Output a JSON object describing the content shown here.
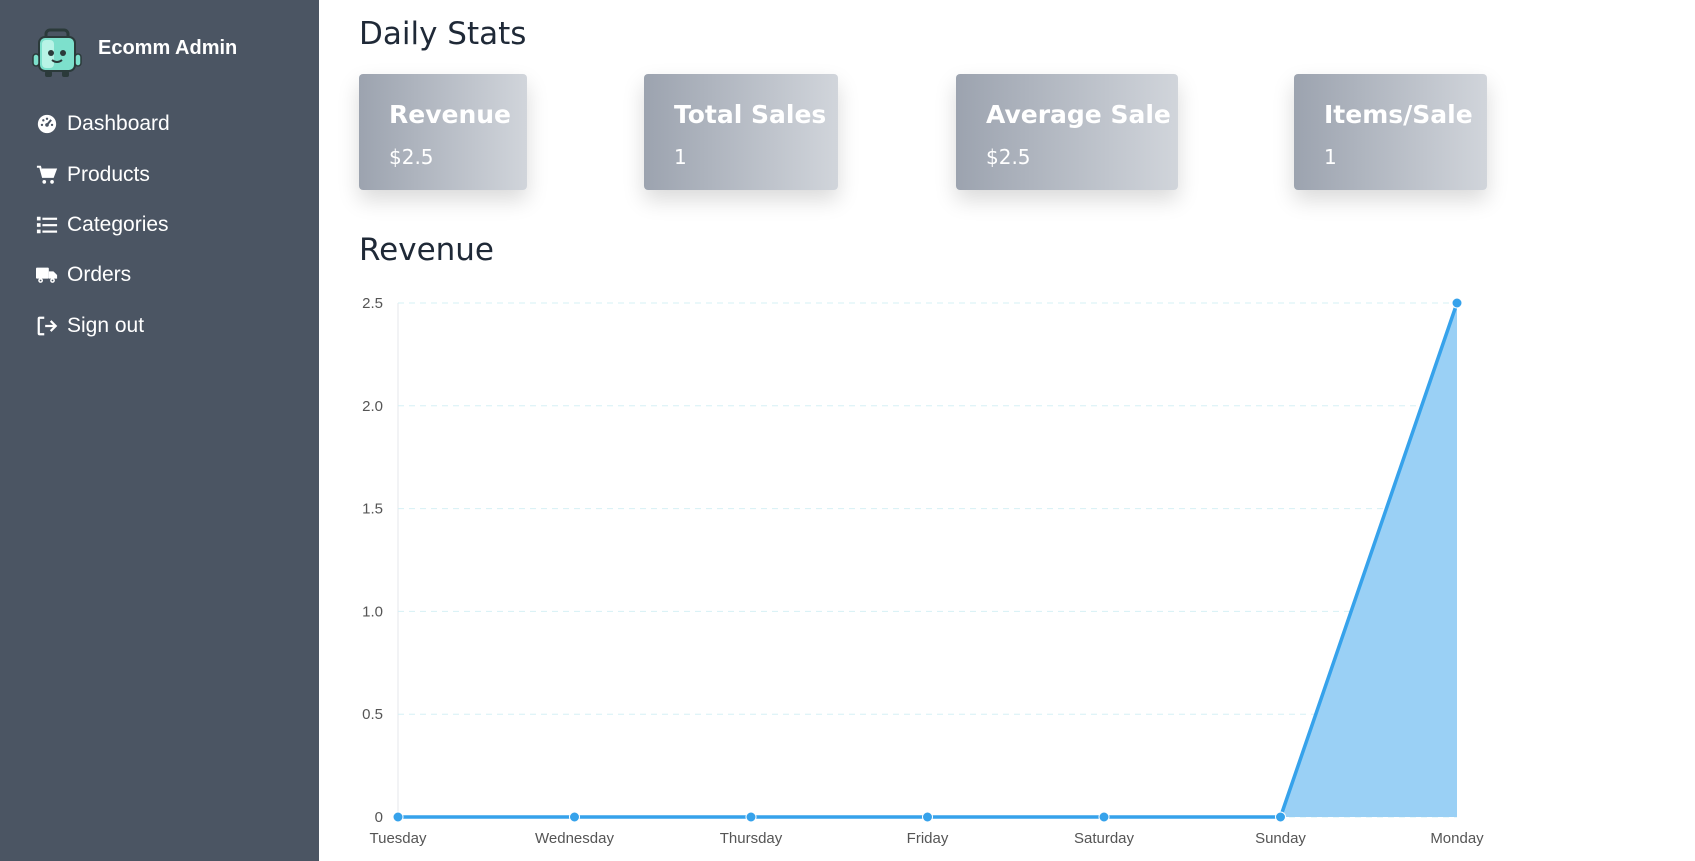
{
  "sidebar": {
    "brand": {
      "name": "Ecomm Admin",
      "logo_icon": "shopping-bag-mascot-icon"
    },
    "items": [
      {
        "label": "Dashboard",
        "icon": "gauge-icon"
      },
      {
        "label": "Products",
        "icon": "cart-icon"
      },
      {
        "label": "Categories",
        "icon": "list-icon"
      },
      {
        "label": "Orders",
        "icon": "truck-icon"
      },
      {
        "label": "Sign out",
        "icon": "sign-out-icon"
      }
    ]
  },
  "main": {
    "daily_title": "Daily Stats",
    "stats": [
      {
        "label": "Revenue",
        "value": "$2.5"
      },
      {
        "label": "Total Sales",
        "value": "1"
      },
      {
        "label": "Average Sale",
        "value": "$2.5"
      },
      {
        "label": "Items/Sale",
        "value": "1"
      }
    ],
    "revenue_title": "Revenue"
  },
  "colors": {
    "sidebar_bg": "#4b5563",
    "line": "#36a2eb",
    "area_fill": "#9ad0f5",
    "grid": "#d6f0f5"
  },
  "chart_data": {
    "type": "area",
    "categories": [
      "Tuesday",
      "Wednesday",
      "Thursday",
      "Friday",
      "Saturday",
      "Sunday",
      "Monday"
    ],
    "series": [
      {
        "values": [
          0,
          0,
          0,
          0,
          0,
          0,
          2.5
        ]
      }
    ],
    "ylim": [
      0,
      2.5
    ],
    "yticks": [
      "0",
      "0.5",
      "1.0",
      "1.5",
      "2.0",
      "2.5"
    ],
    "grid": true,
    "legend": "none",
    "fill": "under last segment"
  }
}
